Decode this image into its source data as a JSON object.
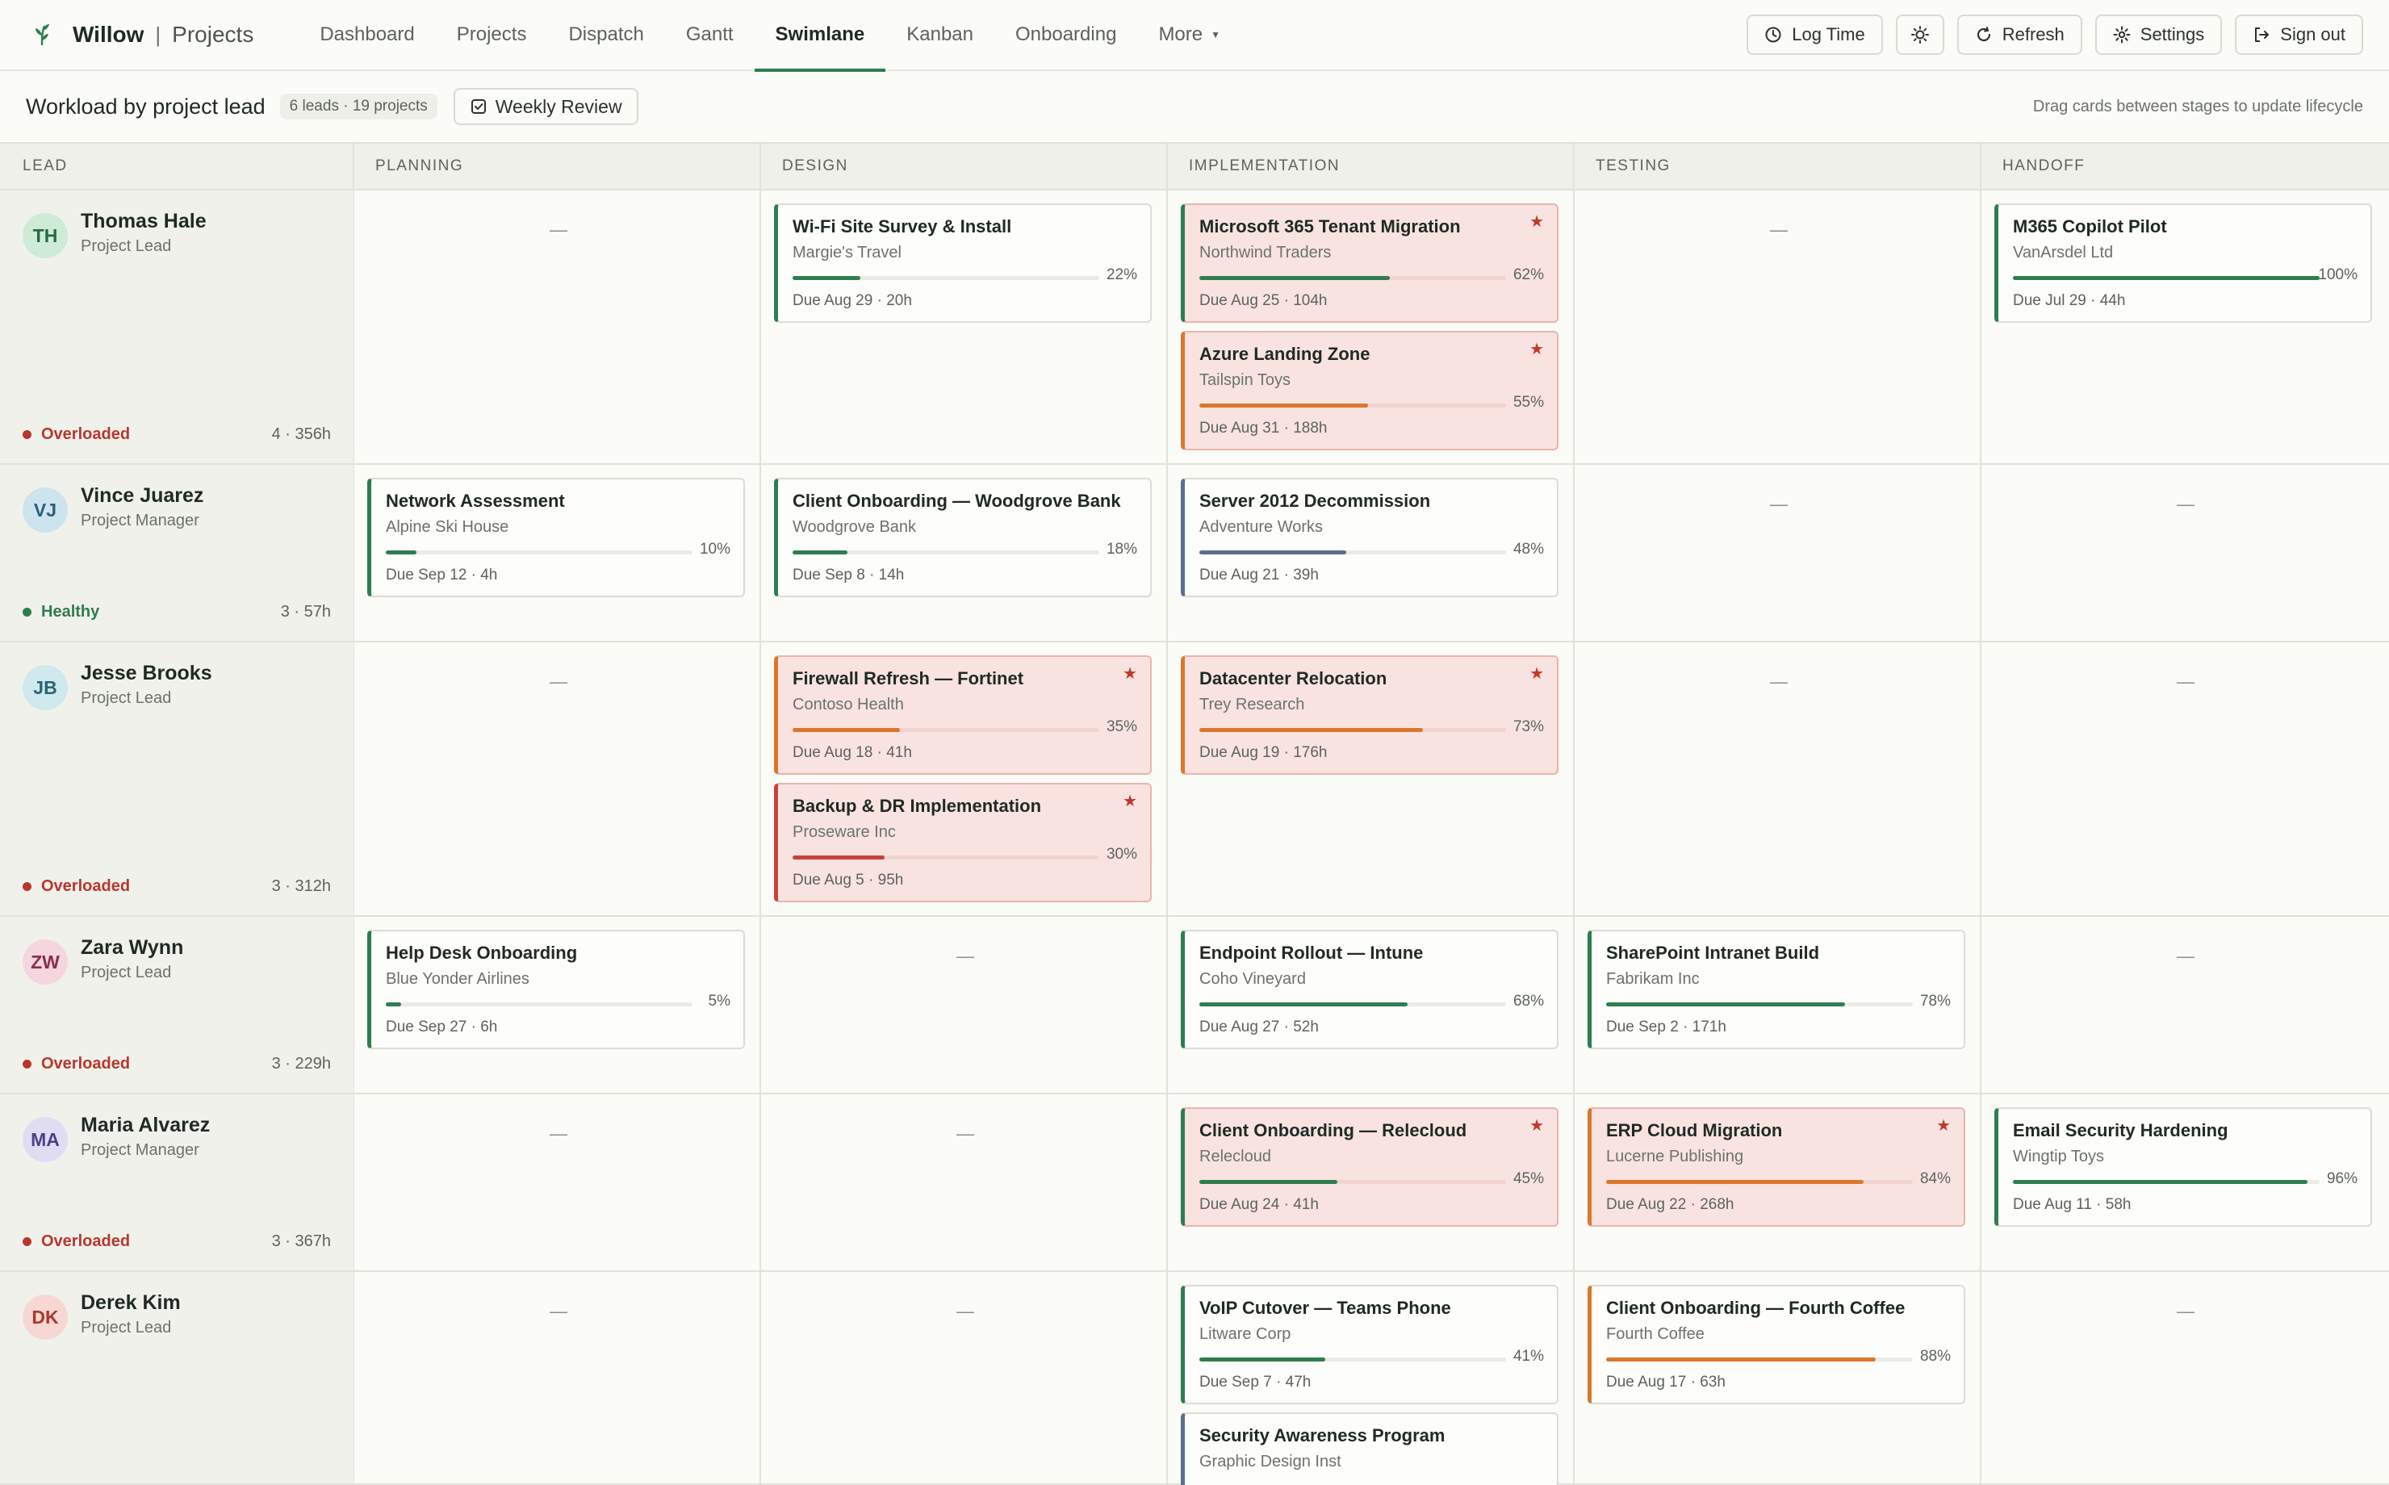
{
  "app": {
    "name": "Willow",
    "separator": "|",
    "section": "Projects",
    "nav": [
      {
        "label": "Dashboard"
      },
      {
        "label": "Projects"
      },
      {
        "label": "Dispatch"
      },
      {
        "label": "Gantt"
      },
      {
        "label": "Swimlane",
        "active": true
      },
      {
        "label": "Kanban"
      },
      {
        "label": "Onboarding"
      },
      {
        "label": "More"
      }
    ],
    "actions": {
      "log_time": "Log Time",
      "refresh": "Refresh",
      "settings": "Settings",
      "sign_out": "Sign out"
    }
  },
  "subheader": {
    "title": "Workload by project lead",
    "count": "6 leads · 19 projects",
    "review": "Weekly Review",
    "hint": "Drag cards between stages to update lifecycle"
  },
  "columns": {
    "lead": "LEAD",
    "planning": "PLANNING",
    "design": "DESIGN",
    "implementation": "IMPLEMENTATION",
    "testing": "TESTING",
    "handoff": "HANDOFF"
  },
  "empty": "—",
  "colors": {
    "green": "#2e7d4f",
    "orange": "#d9782d",
    "red": "#c7433a",
    "slate": "#5a6f8a"
  },
  "lanes": [
    {
      "initials": "TH",
      "name": "Thomas Hale",
      "role": "Project Lead",
      "status": "Overloaded",
      "load": "4 · 356h",
      "cards": [
        {
          "stage": 1,
          "title": "Wi-Fi Site Survey & Install",
          "client": "Margie's Travel",
          "progress": 22,
          "pct": "22%",
          "due": "Due Aug 29 · 20h",
          "color": "green",
          "hot": false
        },
        {
          "stage": 2,
          "title": "Microsoft 365 Tenant Migration",
          "client": "Northwind Traders",
          "progress": 62,
          "pct": "62%",
          "due": "Due Aug 25 · 104h",
          "color": "green",
          "hot": true
        },
        {
          "stage": 2,
          "title": "Azure Landing Zone",
          "client": "Tailspin Toys",
          "progress": 55,
          "pct": "55%",
          "due": "Due Aug 31 · 188h",
          "color": "orange",
          "hot": true
        },
        {
          "stage": 4,
          "title": "M365 Copilot Pilot",
          "client": "VanArsdel Ltd",
          "progress": 100,
          "pct": "100%",
          "due": "Due Jul 29 · 44h",
          "color": "green",
          "hot": false
        }
      ]
    },
    {
      "initials": "VJ",
      "name": "Vince Juarez",
      "role": "Project Manager",
      "status": "Healthy",
      "load": "3 · 57h",
      "cards": [
        {
          "stage": 0,
          "title": "Network Assessment",
          "client": "Alpine Ski House",
          "progress": 10,
          "pct": "10%",
          "due": "Due Sep 12 · 4h",
          "color": "green",
          "hot": false
        },
        {
          "stage": 1,
          "title": "Client Onboarding — Woodgrove Bank",
          "client": "Woodgrove Bank",
          "progress": 18,
          "pct": "18%",
          "due": "Due Sep 8 · 14h",
          "color": "green",
          "hot": false
        },
        {
          "stage": 2,
          "title": "Server 2012 Decommission",
          "client": "Adventure Works",
          "progress": 48,
          "pct": "48%",
          "due": "Due Aug 21 · 39h",
          "color": "slate",
          "hot": false
        }
      ]
    },
    {
      "initials": "JB",
      "name": "Jesse Brooks",
      "role": "Project Lead",
      "status": "Overloaded",
      "load": "3 · 312h",
      "cards": [
        {
          "stage": 1,
          "title": "Firewall Refresh — Fortinet",
          "client": "Contoso Health",
          "progress": 35,
          "pct": "35%",
          "due": "Due Aug 18 · 41h",
          "color": "orange",
          "hot": true
        },
        {
          "stage": 1,
          "title": "Backup & DR Implementation",
          "client": "Proseware Inc",
          "progress": 30,
          "pct": "30%",
          "due": "Due Aug 5 · 95h",
          "color": "red",
          "hot": true
        },
        {
          "stage": 2,
          "title": "Datacenter Relocation",
          "client": "Trey Research",
          "progress": 73,
          "pct": "73%",
          "due": "Due Aug 19 · 176h",
          "color": "orange",
          "hot": true
        }
      ]
    },
    {
      "initials": "ZW",
      "name": "Zara Wynn",
      "role": "Project Lead",
      "status": "Overloaded",
      "load": "3 · 229h",
      "cards": [
        {
          "stage": 0,
          "title": "Help Desk Onboarding",
          "client": "Blue Yonder Airlines",
          "progress": 5,
          "pct": "5%",
          "due": "Due Sep 27 · 6h",
          "color": "green",
          "hot": false
        },
        {
          "stage": 2,
          "title": "Endpoint Rollout — Intune",
          "client": "Coho Vineyard",
          "progress": 68,
          "pct": "68%",
          "due": "Due Aug 27 · 52h",
          "color": "green",
          "hot": false
        },
        {
          "stage": 3,
          "title": "SharePoint Intranet Build",
          "client": "Fabrikam Inc",
          "progress": 78,
          "pct": "78%",
          "due": "Due Sep 2 · 171h",
          "color": "green",
          "hot": false
        }
      ]
    },
    {
      "initials": "MA",
      "name": "Maria Alvarez",
      "role": "Project Manager",
      "status": "Overloaded",
      "load": "3 · 367h",
      "cards": [
        {
          "stage": 2,
          "title": "Client Onboarding — Relecloud",
          "client": "Relecloud",
          "progress": 45,
          "pct": "45%",
          "due": "Due Aug 24 · 41h",
          "color": "green",
          "hot": true
        },
        {
          "stage": 3,
          "title": "ERP Cloud Migration",
          "client": "Lucerne Publishing",
          "progress": 84,
          "pct": "84%",
          "due": "Due Aug 22 · 268h",
          "color": "orange",
          "hot": true
        },
        {
          "stage": 4,
          "title": "Email Security Hardening",
          "client": "Wingtip Toys",
          "progress": 96,
          "pct": "96%",
          "due": "Due Aug 11 · 58h",
          "color": "green",
          "hot": false
        }
      ]
    },
    {
      "initials": "DK",
      "name": "Derek Kim",
      "role": "Project Lead",
      "status": "",
      "load": "",
      "cards": [
        {
          "stage": 2,
          "title": "VoIP Cutover — Teams Phone",
          "client": "Litware Corp",
          "progress": 41,
          "pct": "41%",
          "due": "Due Sep 7 · 47h",
          "color": "green",
          "hot": false
        },
        {
          "stage": 2,
          "title": "Security Awareness Program",
          "client": "Graphic Design Inst",
          "progress": 0,
          "pct": "",
          "due": "",
          "color": "slate",
          "hot": false
        },
        {
          "stage": 3,
          "title": "Client Onboarding — Fourth Coffee",
          "client": "Fourth Coffee",
          "progress": 88,
          "pct": "88%",
          "due": "Due Aug 17 · 63h",
          "color": "orange",
          "hot": false
        }
      ]
    }
  ]
}
